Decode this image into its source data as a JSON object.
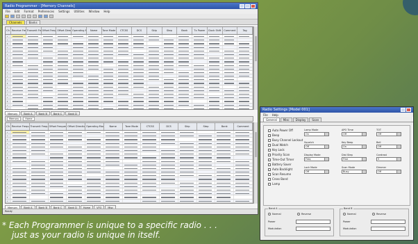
{
  "spreadsheet": {
    "title": "Radio Programmer - [Memory Channels]",
    "menu": [
      "File",
      "Edit",
      "Format",
      "Preferences",
      "Settings",
      "Utilities",
      "Window",
      "Help"
    ],
    "tabs": [
      "Channels",
      "Banks"
    ],
    "columns": [
      "Ch",
      "Receive Frequency",
      "Transmit Frequency",
      "Offset Frequency",
      "Offset Direction",
      "Operating Mode",
      "Name",
      "Tone Mode",
      "CTCSS",
      "DCS",
      "Skip",
      "Step",
      "Bank",
      "Tx Power",
      "Clock Shift",
      "Comment",
      "Tag"
    ],
    "lower_tabs": [
      "Memory",
      "Home"
    ],
    "lower_columns": [
      "Ch",
      "Receive Frequency",
      "Transmit Frequency",
      "Offset Frequency",
      "Offset Direction",
      "Operating Mode",
      "Name",
      "Tone Mode",
      "CTCSS",
      "DCS",
      "Skip",
      "Step",
      "Bank",
      "Comment"
    ],
    "sheet_tabs": [
      "Memory",
      "Bank A",
      "Bank B",
      "Bank C",
      "Bank D",
      "Home",
      "VFO",
      "Misc"
    ],
    "status": "Ready"
  },
  "dialog": {
    "title": "Radio Settings [Model 001]",
    "menu": [
      "File",
      "Help"
    ],
    "tabs": [
      "General",
      "Misc",
      "Display",
      "Scan"
    ],
    "checkboxes": [
      "Auto Power Off",
      "Beep",
      "Busy Channel Lockout",
      "Dual Watch",
      "Key Lock",
      "Priority Scan",
      "Time-Out Timer",
      "Battery Saver",
      "Auto Backlight",
      "Scan Resume",
      "Cross Band",
      "Lamp"
    ],
    "fields": [
      {
        "label": "Lamp Mode",
        "value": "On"
      },
      {
        "label": "Squelch",
        "value": "Off"
      },
      {
        "label": "Display Mode",
        "value": "Freq"
      },
      {
        "label": "Lock Mode",
        "value": "Off"
      },
      {
        "label": "APO Time",
        "value": "Off"
      },
      {
        "label": "Key Beep",
        "value": "On"
      },
      {
        "label": "Dial Step",
        "value": "Fine"
      },
      {
        "label": "Scan Mode",
        "value": "Busy"
      },
      {
        "label": "TOT",
        "value": "Off"
      },
      {
        "label": "Bell",
        "value": "Off"
      },
      {
        "label": "Contrast",
        "value": "5"
      },
      {
        "label": "Dimmer",
        "value": "Off"
      }
    ],
    "group_a": {
      "label": "Band A",
      "options": [
        "Normal",
        "Reverse"
      ],
      "field1": "Power",
      "field2": "Modulation"
    },
    "group_b": {
      "label": "Band B",
      "options": [
        "Normal",
        "Reverse"
      ],
      "field1": "Power",
      "field2": "Modulation"
    }
  },
  "caption": {
    "line1": "* Each Programmer is unique to a specific radio . . .",
    "line2": "just as your radio is unique in itself."
  }
}
